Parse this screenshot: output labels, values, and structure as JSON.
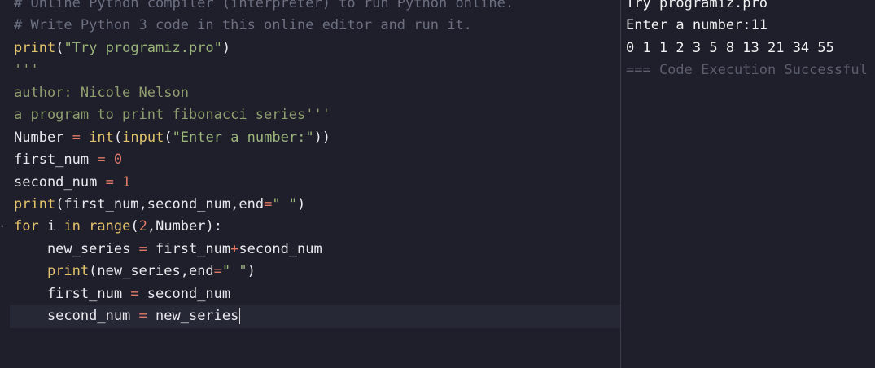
{
  "editor": {
    "lines": [
      {
        "tokens": [
          {
            "t": "# Online Python compiler (interpreter) to run Python online.",
            "c": "comment"
          }
        ]
      },
      {
        "tokens": [
          {
            "t": "# Write Python 3 code in this online editor and run it.",
            "c": "comment"
          }
        ]
      },
      {
        "tokens": [
          {
            "t": "print",
            "c": "fn"
          },
          {
            "t": "(",
            "c": "var"
          },
          {
            "t": "\"Try programiz.pro\"",
            "c": "str"
          },
          {
            "t": ")",
            "c": "var"
          }
        ]
      },
      {
        "tokens": [
          {
            "t": "'''",
            "c": "doc"
          }
        ]
      },
      {
        "tokens": [
          {
            "t": "author: Nicole Nelson",
            "c": "doc"
          }
        ]
      },
      {
        "tokens": [
          {
            "t": "a program to print fibonacci series'''",
            "c": "doc"
          }
        ]
      },
      {
        "tokens": [
          {
            "t": "Number ",
            "c": "var"
          },
          {
            "t": "=",
            "c": "op"
          },
          {
            "t": " ",
            "c": "var"
          },
          {
            "t": "int",
            "c": "fn"
          },
          {
            "t": "(",
            "c": "var"
          },
          {
            "t": "input",
            "c": "fn"
          },
          {
            "t": "(",
            "c": "var"
          },
          {
            "t": "\"Enter a number:\"",
            "c": "str"
          },
          {
            "t": "))",
            "c": "var"
          }
        ]
      },
      {
        "tokens": [
          {
            "t": "first_num ",
            "c": "var"
          },
          {
            "t": "=",
            "c": "op"
          },
          {
            "t": " ",
            "c": "var"
          },
          {
            "t": "0",
            "c": "num"
          }
        ]
      },
      {
        "tokens": [
          {
            "t": "second_num ",
            "c": "var"
          },
          {
            "t": "=",
            "c": "op"
          },
          {
            "t": " ",
            "c": "var"
          },
          {
            "t": "1",
            "c": "num"
          }
        ]
      },
      {
        "tokens": [
          {
            "t": "print",
            "c": "fn"
          },
          {
            "t": "(first_num,second_num,end",
            "c": "var"
          },
          {
            "t": "=",
            "c": "op"
          },
          {
            "t": "\" \"",
            "c": "str"
          },
          {
            "t": ")",
            "c": "var"
          }
        ]
      },
      {
        "tokens": [
          {
            "t": "for",
            "c": "kw"
          },
          {
            "t": " i ",
            "c": "var"
          },
          {
            "t": "in",
            "c": "kw"
          },
          {
            "t": " ",
            "c": "var"
          },
          {
            "t": "range",
            "c": "fn"
          },
          {
            "t": "(",
            "c": "var"
          },
          {
            "t": "2",
            "c": "num"
          },
          {
            "t": ",Number):",
            "c": "var"
          }
        ]
      },
      {
        "tokens": [
          {
            "t": "    new_series ",
            "c": "var"
          },
          {
            "t": "=",
            "c": "op"
          },
          {
            "t": " first_num",
            "c": "var"
          },
          {
            "t": "+",
            "c": "op"
          },
          {
            "t": "second_num",
            "c": "var"
          }
        ]
      },
      {
        "tokens": [
          {
            "t": "    ",
            "c": "var"
          },
          {
            "t": "print",
            "c": "fn"
          },
          {
            "t": "(new_series,end",
            "c": "var"
          },
          {
            "t": "=",
            "c": "op"
          },
          {
            "t": "\" \"",
            "c": "str"
          },
          {
            "t": ")",
            "c": "var"
          }
        ]
      },
      {
        "tokens": [
          {
            "t": "    first_num ",
            "c": "var"
          },
          {
            "t": "=",
            "c": "op"
          },
          {
            "t": " second_num",
            "c": "var"
          }
        ]
      },
      {
        "tokens": [
          {
            "t": "    second_num ",
            "c": "var"
          },
          {
            "t": "=",
            "c": "op"
          },
          {
            "t": " new_series",
            "c": "var"
          }
        ],
        "active": true
      }
    ]
  },
  "output": {
    "lines": [
      {
        "text": "Try programiz.pro",
        "status": false
      },
      {
        "text": "Enter a number:11",
        "status": false
      },
      {
        "text": "0 1 1 2 3 5 8 13 21 34 55",
        "status": false
      },
      {
        "text": "=== Code Execution Successful ===",
        "status": true
      }
    ]
  },
  "colors": {
    "background": "#1e1f2a",
    "active_line": "#262835",
    "comment": "#6b6f80",
    "function": "#e2c26a",
    "string": "#9bb47a",
    "number": "#e0786a",
    "status_text": "#5a5d6c"
  },
  "icons": {
    "fold_marker": "chevron-down-icon"
  }
}
